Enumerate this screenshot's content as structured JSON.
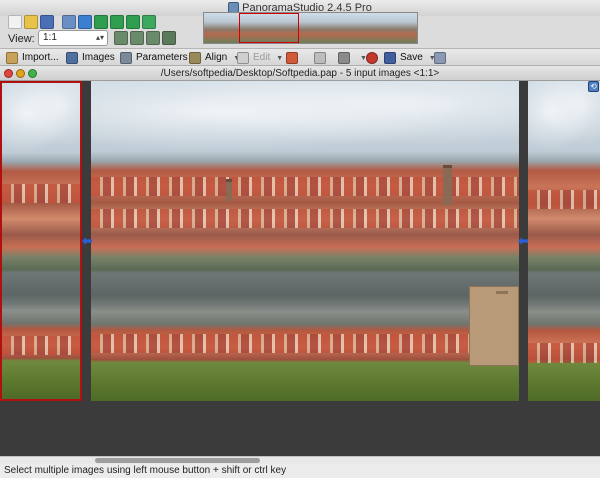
{
  "window": {
    "title": "PanoramaStudio 2.4.5 Pro"
  },
  "top_toolbar": {
    "icons": [
      {
        "name": "new-icon",
        "color": "#f2f2f2"
      },
      {
        "name": "open-icon",
        "color": "#e8c34a"
      },
      {
        "name": "save-icon",
        "color": "#4a6fb5"
      },
      {
        "name": "settings-icon",
        "color": "#6a8fc5"
      },
      {
        "name": "info-icon",
        "color": "#3a7fd0"
      },
      {
        "name": "help-icon",
        "color": "#2f9f4f"
      },
      {
        "name": "rotate-left-icon",
        "color": "#2f9f4f"
      },
      {
        "name": "rotate-right-icon",
        "color": "#2f9f4f"
      },
      {
        "name": "undo-icon",
        "color": "#3fa85f"
      }
    ],
    "zoom_icons": [
      {
        "name": "zoom-in-icon",
        "color": "#6a8a6a"
      },
      {
        "name": "zoom-out-icon",
        "color": "#6a8a6a"
      },
      {
        "name": "zoom-fit-icon",
        "color": "#6a8a6a"
      },
      {
        "name": "zoom-full-icon",
        "color": "#5a7a5a"
      }
    ],
    "view_label": "View:",
    "view_value": "1:1"
  },
  "main_toolbar": {
    "import": "Import...",
    "images": "Images",
    "parameters": "Parameters",
    "align": "Align",
    "edit": "Edit",
    "save": "Save"
  },
  "document": {
    "title": "/Users/softpedia/Desktop/Softpedia.pap - 5 input images <1:1>"
  },
  "status": {
    "text": "Select multiple images using left mouse button + shift or ctrl key"
  },
  "colors": {
    "selected_border": "#b01010",
    "seam_arrow": "#2a5fd6",
    "canvas_bg": "#3b3b3b"
  }
}
